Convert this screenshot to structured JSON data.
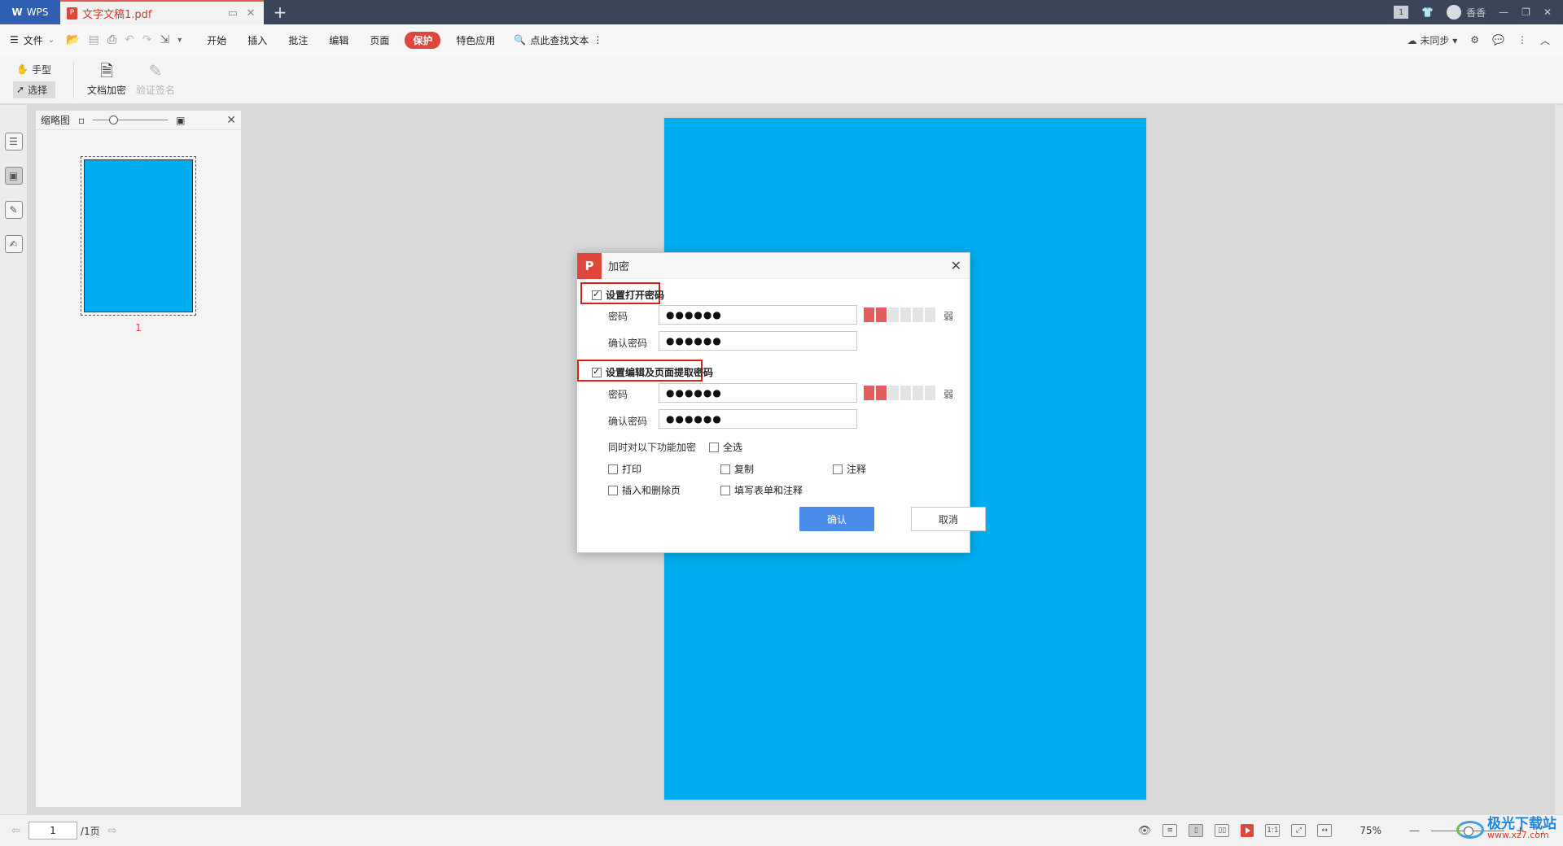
{
  "titlebar": {
    "app_label": "WPS",
    "doc_tab": "文字文稿1.pdf",
    "new_tab": "+",
    "page_count_badge": "1",
    "user": "香香",
    "min": "—",
    "restore": "❐",
    "close": "✕"
  },
  "menubar": {
    "file": "文件",
    "tabs": [
      "开始",
      "插入",
      "批注",
      "编辑",
      "页面",
      "保护",
      "特色应用"
    ],
    "active_tab": "保护",
    "search": "点此查找文本",
    "sync": "未同步"
  },
  "ribbon": {
    "hand": "手型",
    "select": "选择",
    "encrypt": "文档加密",
    "verify": "验证签名"
  },
  "thumbnail_panel": {
    "title": "缩略图",
    "page_number": "1"
  },
  "dialog": {
    "title": "加密",
    "open_pwd_check": "设置打开密码",
    "edit_pwd_check": "设置编辑及页面提取密码",
    "password_label": "密码",
    "confirm_label": "确认密码",
    "open_password": "●●●●●●",
    "open_confirm": "●●●●●●",
    "edit_password": "●●●●●●",
    "edit_confirm": "●●●●●●",
    "strength_label": "弱",
    "encrypt_also": "同时对以下功能加密",
    "select_all": "全选",
    "options": [
      "打印",
      "复制",
      "注释",
      "插入和删除页",
      "填写表单和注释"
    ],
    "ok": "确认",
    "cancel": "取消"
  },
  "statusbar": {
    "page_input": "1",
    "total_pages": "/1页",
    "zoom": "75%"
  },
  "watermark": {
    "name": "极光下载站",
    "url": "www.xz7.com"
  },
  "colors": {
    "accent": "#e0473c",
    "page": "#00aef0",
    "ok_button": "#4a8cea",
    "highlight": "#d9221c"
  }
}
